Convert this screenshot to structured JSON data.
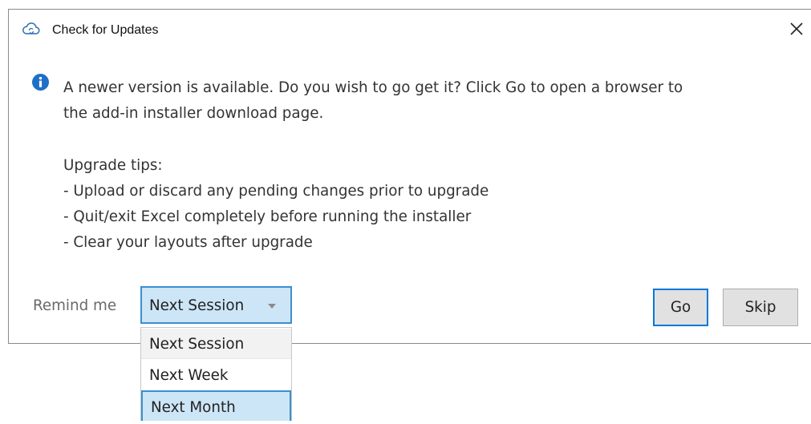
{
  "window": {
    "title": "Check for Updates",
    "title_icon": "cloud-sync-icon",
    "close_icon": "close-icon"
  },
  "message": {
    "icon": "info-icon",
    "line1": "A newer version is available. Do you wish to go get it?  Click Go to open a browser to",
    "line2": "the add-in installer download page."
  },
  "tips": {
    "heading": "Upgrade tips:",
    "items": [
      "- Upload or discard any pending changes prior to upgrade",
      "- Quit/exit Excel completely before running the installer",
      "- Clear your layouts after upgrade"
    ]
  },
  "remind": {
    "label": "Remind me",
    "selected": "Next Session",
    "options": [
      "Next Session",
      "Next Week",
      "Next Month"
    ],
    "highlighted_option": "Next Month"
  },
  "buttons": {
    "go_label": "Go",
    "skip_label": "Skip"
  },
  "colors": {
    "info_blue": "#1e6fc8",
    "select_fill": "#cde6f7",
    "select_border": "#3c8fcd",
    "default_button_border": "#0078d7"
  }
}
